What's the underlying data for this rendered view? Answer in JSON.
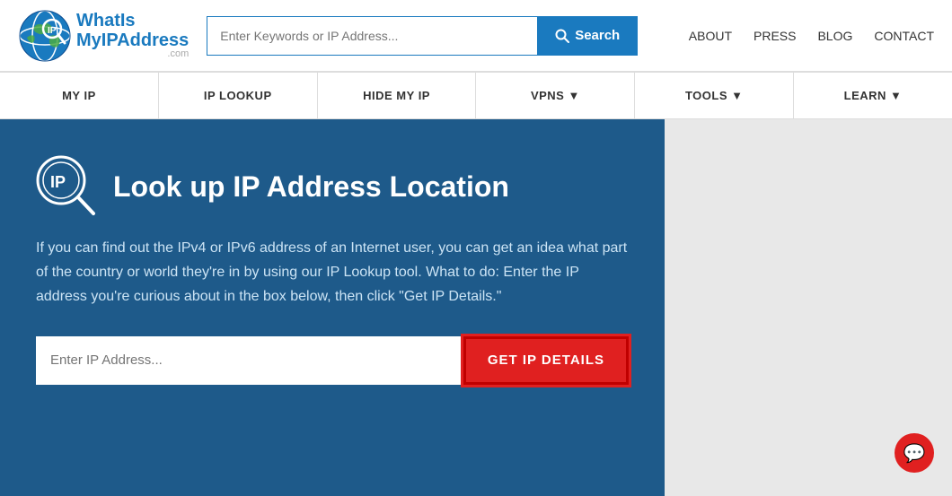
{
  "header": {
    "logo": {
      "line1": "WhatIs",
      "line2": "MyIPAddress",
      "com": ".com"
    },
    "search": {
      "placeholder": "Enter Keywords or IP Address...",
      "button_label": "Search"
    },
    "top_nav": [
      {
        "label": "ABOUT",
        "href": "#"
      },
      {
        "label": "PRESS",
        "href": "#"
      },
      {
        "label": "BLOG",
        "href": "#"
      },
      {
        "label": "CONTACT",
        "href": "#"
      }
    ]
  },
  "main_nav": [
    {
      "label": "MY IP",
      "href": "#"
    },
    {
      "label": "IP LOOKUP",
      "href": "#"
    },
    {
      "label": "HIDE MY IP",
      "href": "#"
    },
    {
      "label": "VPNS ▼",
      "href": "#"
    },
    {
      "label": "TOOLS ▼",
      "href": "#"
    },
    {
      "label": "LEARN ▼",
      "href": "#"
    }
  ],
  "hero": {
    "title": "Look up IP Address Location",
    "description": "If you can find out the IPv4 or IPv6 address of an Internet user, you can get an idea what part of the country or world they're in by using our IP Lookup tool. What to do: Enter the IP address you're curious about in the box below, then click \"Get IP Details.\"",
    "ip_input_placeholder": "Enter IP Address...",
    "ip_button_label": "GET IP DETAILS"
  },
  "colors": {
    "primary_blue": "#1a7abf",
    "nav_bg": "#1e5a8a",
    "button_red": "#e02020"
  }
}
